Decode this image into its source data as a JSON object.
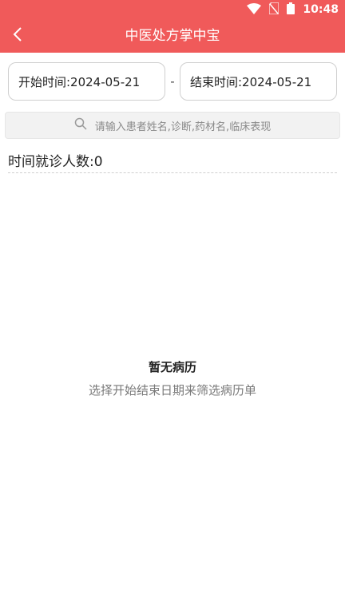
{
  "status_bar": {
    "time": "10:48",
    "icons": [
      "wifi-icon",
      "no-sim-icon",
      "battery-icon"
    ]
  },
  "app_bar": {
    "title": "中医处方掌中宝",
    "back_icon": "chevron-left-icon"
  },
  "filters": {
    "start_date": "开始时间:2024-05-21",
    "separator": "-",
    "end_date": "结束时间:2024-05-21"
  },
  "search": {
    "placeholder": "请输入患者姓名,诊断,药材名,临床表现",
    "icon": "search-icon"
  },
  "summary": {
    "label": "时间就诊人数:",
    "count": "0"
  },
  "empty_state": {
    "title": "暂无病历",
    "subtitle": "选择开始结束日期来筛选病历单"
  },
  "colors": {
    "primary": "#f05a5a",
    "background": "#ffffff",
    "search_bg": "#f2f2f2"
  }
}
